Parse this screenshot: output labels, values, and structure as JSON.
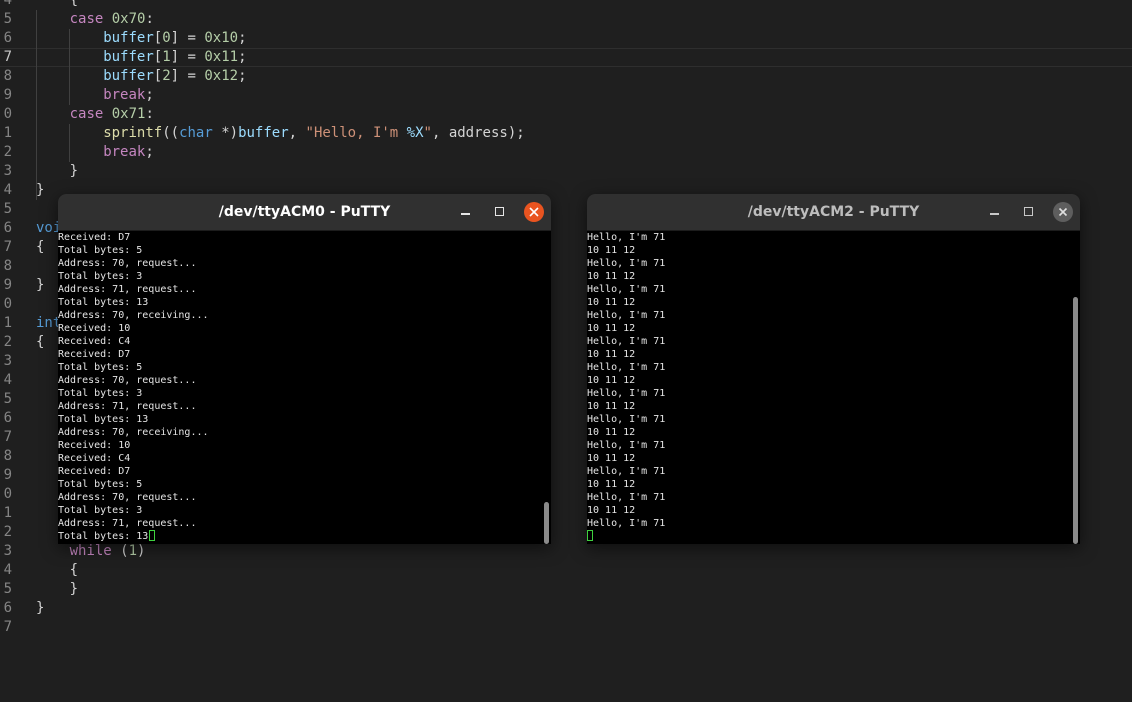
{
  "editor": {
    "lines": [
      {
        "num": "4",
        "indent": 1,
        "tokens": [
          {
            "t": "{",
            "c": "p"
          }
        ]
      },
      {
        "num": "5",
        "indent": 1,
        "tokens": [
          {
            "t": "case ",
            "c": "kw"
          },
          {
            "t": "0x70",
            "c": "num"
          },
          {
            "t": ":",
            "c": "p"
          }
        ]
      },
      {
        "num": "6",
        "indent": 2,
        "tokens": [
          {
            "t": "buffer",
            "c": "var"
          },
          {
            "t": "[",
            "c": "p"
          },
          {
            "t": "0",
            "c": "num"
          },
          {
            "t": "] = ",
            "c": "p"
          },
          {
            "t": "0x10",
            "c": "num"
          },
          {
            "t": ";",
            "c": "p"
          }
        ]
      },
      {
        "num": "7",
        "indent": 2,
        "current": true,
        "tokens": [
          {
            "t": "buffer",
            "c": "var"
          },
          {
            "t": "[",
            "c": "p"
          },
          {
            "t": "1",
            "c": "num"
          },
          {
            "t": "] = ",
            "c": "p"
          },
          {
            "t": "0x11",
            "c": "num"
          },
          {
            "t": ";",
            "c": "p"
          }
        ]
      },
      {
        "num": "8",
        "indent": 2,
        "tokens": [
          {
            "t": "buffer",
            "c": "var"
          },
          {
            "t": "[",
            "c": "p"
          },
          {
            "t": "2",
            "c": "num"
          },
          {
            "t": "] = ",
            "c": "p"
          },
          {
            "t": "0x12",
            "c": "num"
          },
          {
            "t": ";",
            "c": "p"
          }
        ]
      },
      {
        "num": "9",
        "indent": 2,
        "tokens": [
          {
            "t": "break",
            "c": "kw"
          },
          {
            "t": ";",
            "c": "p"
          }
        ]
      },
      {
        "num": "0",
        "indent": 1,
        "tokens": [
          {
            "t": "case ",
            "c": "kw"
          },
          {
            "t": "0x71",
            "c": "num"
          },
          {
            "t": ":",
            "c": "p"
          }
        ]
      },
      {
        "num": "1",
        "indent": 2,
        "tokens": [
          {
            "t": "sprintf",
            "c": "fn"
          },
          {
            "t": "((",
            "c": "p"
          },
          {
            "t": "char",
            "c": "ty"
          },
          {
            "t": " *)",
            "c": "p"
          },
          {
            "t": "buffer",
            "c": "var"
          },
          {
            "t": ", ",
            "c": "p"
          },
          {
            "t": "\"Hello, I'm ",
            "c": "str"
          },
          {
            "t": "%X",
            "c": "fmt"
          },
          {
            "t": "\"",
            "c": "str"
          },
          {
            "t": ", address);",
            "c": "p"
          }
        ]
      },
      {
        "num": "2",
        "indent": 2,
        "tokens": [
          {
            "t": "break",
            "c": "kw"
          },
          {
            "t": ";",
            "c": "p"
          }
        ]
      },
      {
        "num": "3",
        "indent": 1,
        "tokens": [
          {
            "t": "}",
            "c": "p"
          }
        ]
      },
      {
        "num": "4",
        "indent": 0,
        "tokens": [
          {
            "t": "}",
            "c": "p"
          }
        ]
      },
      {
        "num": "5",
        "indent": 0,
        "tokens": []
      },
      {
        "num": "6",
        "indent": 0,
        "tokens": [
          {
            "t": "voi",
            "c": "ty"
          }
        ]
      },
      {
        "num": "7",
        "indent": 0,
        "tokens": [
          {
            "t": "{",
            "c": "p"
          }
        ]
      },
      {
        "num": "8",
        "indent": 0,
        "tokens": []
      },
      {
        "num": "9",
        "indent": 0,
        "tokens": [
          {
            "t": "}",
            "c": "p"
          }
        ]
      },
      {
        "num": "0",
        "indent": 0,
        "tokens": []
      },
      {
        "num": "1",
        "indent": 0,
        "tokens": [
          {
            "t": "int",
            "c": "ty"
          }
        ]
      },
      {
        "num": "2",
        "indent": 0,
        "tokens": [
          {
            "t": "{",
            "c": "p"
          }
        ]
      },
      {
        "num": "3",
        "indent": 0,
        "tokens": []
      },
      {
        "num": "4",
        "indent": 0,
        "tokens": []
      },
      {
        "num": "5",
        "indent": 0,
        "tokens": []
      },
      {
        "num": "6",
        "indent": 0,
        "tokens": []
      },
      {
        "num": "7",
        "indent": 0,
        "tokens": []
      },
      {
        "num": "8",
        "indent": 0,
        "tokens": []
      },
      {
        "num": "9",
        "indent": 0,
        "tokens": []
      },
      {
        "num": "0",
        "indent": 0,
        "tokens": []
      },
      {
        "num": "1",
        "indent": 0,
        "tokens": []
      },
      {
        "num": "2",
        "indent": 0,
        "tokens": []
      },
      {
        "num": "3",
        "indent": 1,
        "tokens": [
          {
            "t": "while",
            "c": "kw"
          },
          {
            "t": " (",
            "c": "p"
          },
          {
            "t": "1",
            "c": "num"
          },
          {
            "t": ")",
            "c": "p"
          }
        ]
      },
      {
        "num": "4",
        "indent": 1,
        "tokens": [
          {
            "t": "{",
            "c": "p"
          }
        ]
      },
      {
        "num": "5",
        "indent": 1,
        "tokens": [
          {
            "t": "}",
            "c": "p"
          }
        ]
      },
      {
        "num": "6",
        "indent": 0,
        "tokens": [
          {
            "t": "}",
            "c": "p"
          }
        ]
      },
      {
        "num": "7",
        "indent": 0,
        "tokens": []
      }
    ]
  },
  "colors": {
    "background": "#1f1f1f",
    "keyword": "#c586c0",
    "type": "#569cd6",
    "function": "#dcdcaa",
    "variable": "#9cdcfe",
    "number": "#b5cea8",
    "string": "#ce9178",
    "close_active": "#e95420",
    "cursor": "#3fd03f"
  },
  "putty_left": {
    "title": "/dev/ttyACM0 - PuTTY",
    "active": true,
    "scroll_position": 1.0,
    "lines": [
      "Received: D7",
      "Total bytes: 5",
      "Address: 70, request...",
      "Total bytes: 3",
      "Address: 71, request...",
      "Total bytes: 13",
      "Address: 70, receiving...",
      "Received: 10",
      "Received: C4",
      "Received: D7",
      "Total bytes: 5",
      "Address: 70, request...",
      "Total bytes: 3",
      "Address: 71, request...",
      "Total bytes: 13",
      "Address: 70, receiving...",
      "Received: 10",
      "Received: C4",
      "Received: D7",
      "Total bytes: 5",
      "Address: 70, request...",
      "Total bytes: 3",
      "Address: 71, request...",
      "Total bytes: 13"
    ]
  },
  "putty_right": {
    "title": "/dev/ttyACM2 - PuTTY",
    "active": false,
    "scroll_position": 1.0,
    "lines": [
      "Hello, I'm 71",
      "10 11 12",
      "Hello, I'm 71",
      "10 11 12",
      "Hello, I'm 71",
      "10 11 12",
      "Hello, I'm 71",
      "10 11 12",
      "Hello, I'm 71",
      "10 11 12",
      "Hello, I'm 71",
      "10 11 12",
      "Hello, I'm 71",
      "10 11 12",
      "Hello, I'm 71",
      "10 11 12",
      "Hello, I'm 71",
      "10 11 12",
      "Hello, I'm 71",
      "10 11 12",
      "Hello, I'm 71",
      "10 11 12",
      "Hello, I'm 71",
      ""
    ]
  },
  "icons": {
    "minimize": "minimize-icon",
    "maximize": "maximize-icon",
    "close": "close-icon",
    "cursor": "terminal-cursor"
  }
}
